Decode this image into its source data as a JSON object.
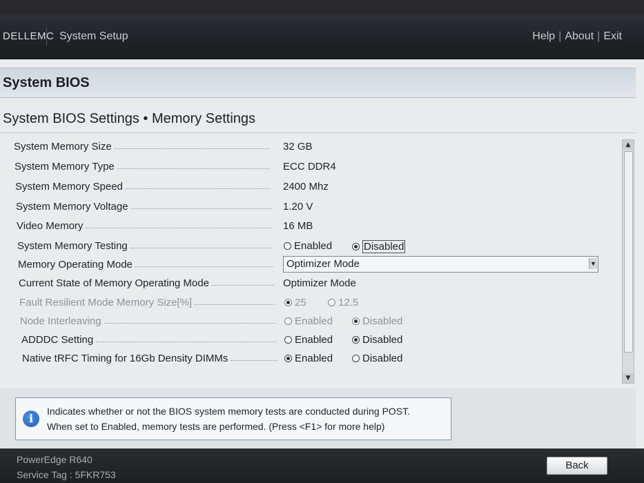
{
  "header": {
    "brand": "DELLEMC",
    "app_title": "System Setup",
    "nav": [
      "Help",
      "About",
      "Exit"
    ]
  },
  "section_title": "System BIOS",
  "page_title": "System BIOS Settings • Memory Settings",
  "settings": {
    "memory_size": {
      "label": "System Memory Size",
      "value": "32 GB"
    },
    "memory_type": {
      "label": "System Memory Type",
      "value": "ECC DDR4"
    },
    "memory_speed": {
      "label": "System Memory Speed",
      "value": "2400 Mhz"
    },
    "memory_voltage": {
      "label": "System Memory Voltage",
      "value": "1.20 V"
    },
    "video_memory": {
      "label": "Video Memory",
      "value": "16 MB"
    },
    "memory_testing": {
      "label": "System Memory Testing",
      "options": [
        "Enabled",
        "Disabled"
      ],
      "selected": "Disabled"
    },
    "operating_mode": {
      "label": "Memory Operating Mode",
      "value": "Optimizer Mode"
    },
    "current_mode": {
      "label": "Current State of Memory Operating Mode",
      "value": "Optimizer Mode"
    },
    "fault_resilient": {
      "label": "Fault Resilient Mode Memory Size[%]",
      "options": [
        "25",
        "12.5"
      ],
      "selected": "25"
    },
    "node_interleaving": {
      "label": "Node Interleaving",
      "options": [
        "Enabled",
        "Disabled"
      ],
      "selected": "Disabled"
    },
    "adddc": {
      "label": "ADDDC Setting",
      "options": [
        "Enabled",
        "Disabled"
      ],
      "selected": "Disabled"
    },
    "trfc": {
      "label": "Native tRFC Timing for 16Gb Density DIMMs",
      "options": [
        "Enabled",
        "Disabled"
      ],
      "selected": "Enabled"
    }
  },
  "help": {
    "line1": "Indicates whether or not the BIOS system memory tests are conducted during POST.",
    "line2": "When set to Enabled, memory tests are performed. (Press <F1> for more help)"
  },
  "footer": {
    "model": "PowerEdge R640",
    "service_tag": "Service Tag : 5FKR753",
    "back_label": "Back"
  }
}
